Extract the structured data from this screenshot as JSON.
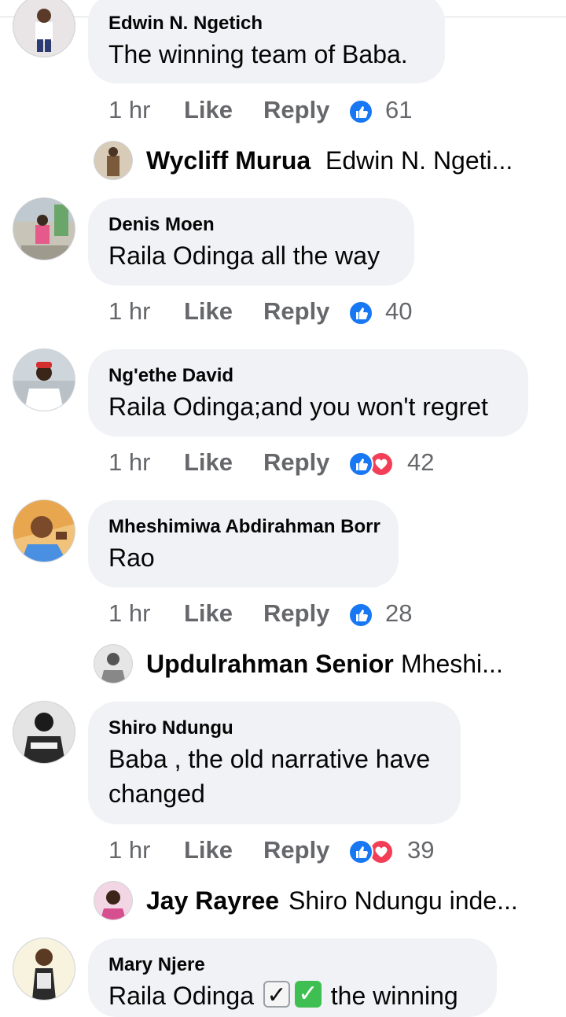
{
  "comments": [
    {
      "author": "Edwin N. Ngetich",
      "text": "The winning team of Baba.",
      "time": "1 hr",
      "like_label": "Like",
      "reply_label": "Reply",
      "reaction_count": "61",
      "reactions": [
        "like"
      ]
    },
    {
      "author": "Denis Moen",
      "text": " Raila Odinga all the way",
      "time": "1 hr",
      "like_label": "Like",
      "reply_label": "Reply",
      "reaction_count": "40",
      "reactions": [
        "like"
      ]
    },
    {
      "author": "Ng'ethe David",
      "text": "Raila Odinga;and you won't regret",
      "time": "1 hr",
      "like_label": "Like",
      "reply_label": "Reply",
      "reaction_count": "42",
      "reactions": [
        "like",
        "love"
      ]
    },
    {
      "author": "Mheshimiwa Abdirahman Borr",
      "text": "Rao",
      "time": "1 hr",
      "like_label": "Like",
      "reply_label": "Reply",
      "reaction_count": "28",
      "reactions": [
        "like"
      ]
    },
    {
      "author": "Shiro Ndungu",
      "text_line1": "Baba , the old narrative have",
      "text_line2": "changed",
      "time": "1 hr",
      "like_label": "Like",
      "reply_label": "Reply",
      "reaction_count": "39",
      "reactions": [
        "like",
        "love"
      ]
    },
    {
      "author": "Mary Njere",
      "text_start": "Raila Odinga",
      "check1": "✓",
      "check2": "✓",
      "text_end": "the winning"
    }
  ],
  "replies": [
    {
      "author": "Wycliff Murua",
      "preview": "Edwin N. Ngeti..."
    },
    {
      "author": "Updulrahman Senior",
      "preview": "Mheshi..."
    },
    {
      "author": "Jay Rayree",
      "preview": "Shiro Ndungu inde..."
    }
  ],
  "colors": {
    "like_blue": "#1877f2",
    "love_red": "#f33e58",
    "bubble": "#f0f2f5",
    "meta_grey": "#65676b"
  }
}
